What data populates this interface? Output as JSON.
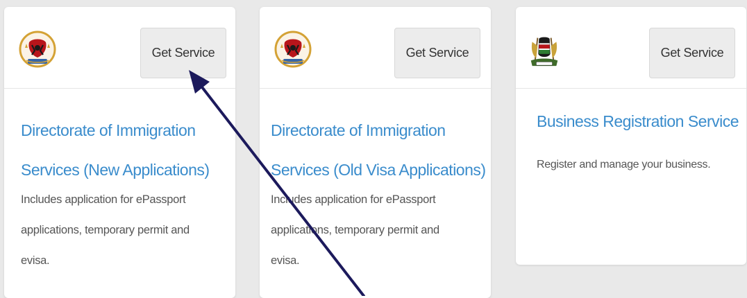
{
  "cards": [
    {
      "logo_icon": "immigration-emblem-icon",
      "button_label": "Get Service",
      "title_line1": "Directorate of Immigration",
      "title_line2": "Services (New Applications)",
      "desc_line1": "Includes application for ePassport",
      "desc_line2": "applications, temporary permit and",
      "desc_line3": "evisa."
    },
    {
      "logo_icon": "immigration-emblem-icon",
      "button_label": "Get Service",
      "title_line1": "Directorate of Immigration",
      "title_line2": "Services (Old Visa Applications)",
      "desc_line1": "Includes application for ePassport",
      "desc_line2": "applications, temporary permit and",
      "desc_line3": "evisa."
    },
    {
      "logo_icon": "kenya-coat-of-arms-icon",
      "button_label": "Get Service",
      "title_line1": "Business Registration Service",
      "desc_line1": "Register and manage your business."
    }
  ],
  "colors": {
    "title": "#3a8ccc",
    "arrow": "#1c1a5c",
    "background": "#e9e9e9"
  }
}
